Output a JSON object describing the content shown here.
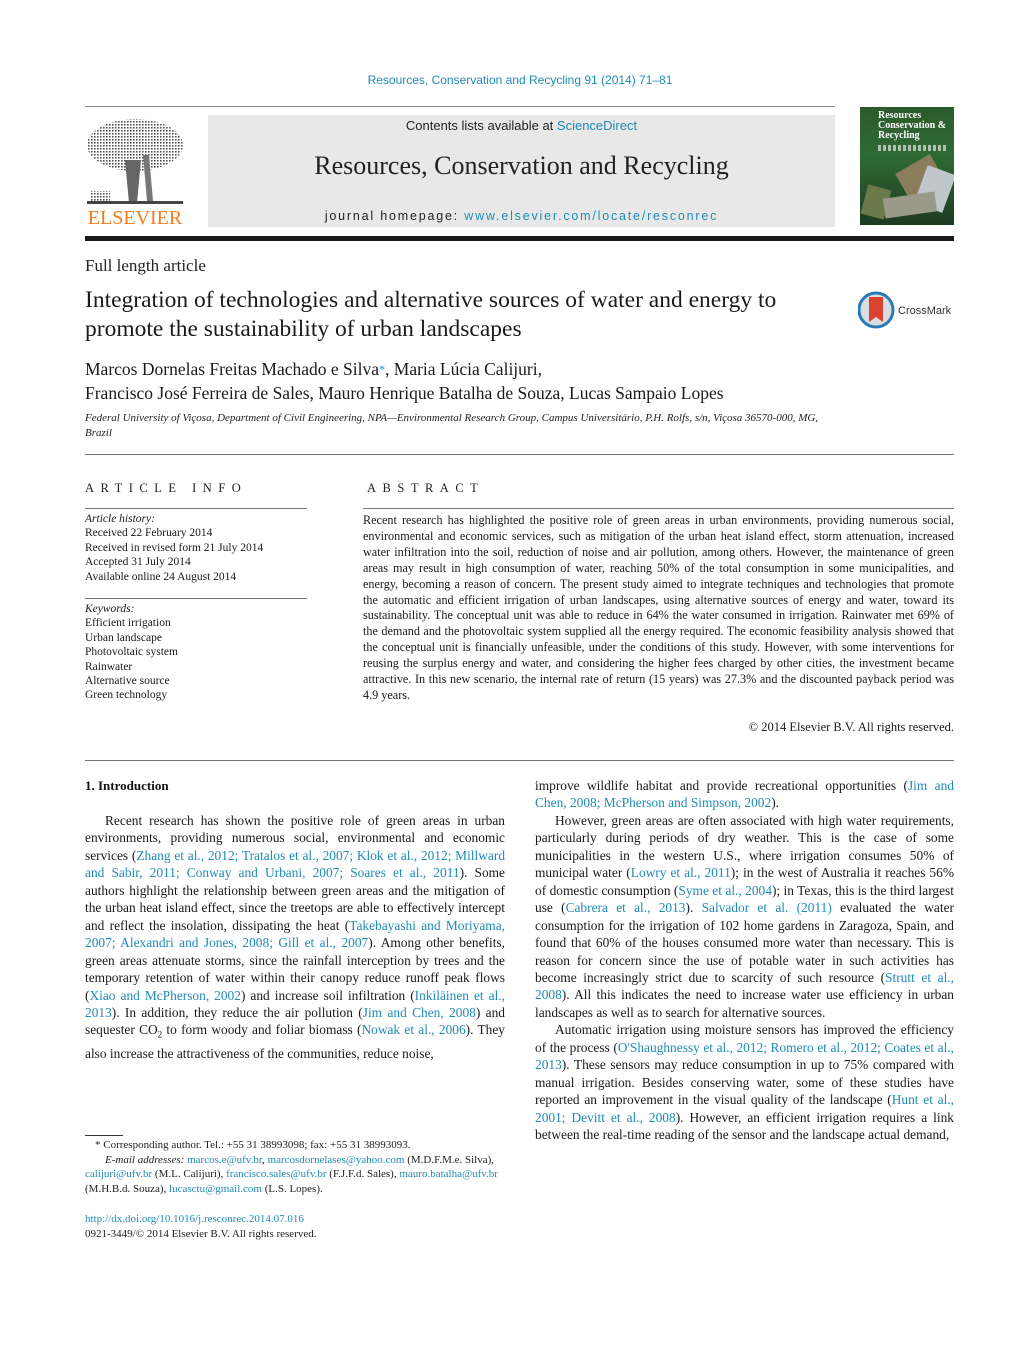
{
  "header": {
    "citation": "Resources, Conservation and Recycling 91 (2014) 71–81",
    "contents_prefix": "Contents lists available at ",
    "contents_link": "ScienceDirect",
    "journal_title": "Resources, Conservation and Recycling",
    "homepage_prefix": "journal homepage: ",
    "homepage_link": "www.elsevier.com/locate/resconrec",
    "publisher_logo_text": "ELSEVIER",
    "cover_title_lines": [
      "Resources",
      "Conservation &",
      "Recycling"
    ],
    "crossmark_label": "CrossMark"
  },
  "article": {
    "type": "Full length article",
    "title": "Integration of technologies and alternative sources of water and energy to promote the sustainability of urban landscapes",
    "authors_line1": "Marcos Dornelas Freitas Machado e Silva",
    "authors_star": "*",
    "authors_line1_rest": ", Maria Lúcia Calijuri,",
    "authors_line2": "Francisco José Ferreira de Sales, Mauro Henrique Batalha de Souza, Lucas Sampaio Lopes",
    "affiliation": "Federal University of Viçosa, Department of Civil Engineering, NPA—Environmental Research Group, Campus Universitário, P.H. Rolfs, s/n, Viçosa 36570-000, MG, Brazil"
  },
  "article_info": {
    "heading": "ARTICLE INFO",
    "history_label": "Article history:",
    "history": [
      "Received 22 February 2014",
      "Received in revised form 21 July 2014",
      "Accepted 31 July 2014",
      "Available online 24 August 2014"
    ],
    "keywords_label": "Keywords:",
    "keywords": [
      "Efficient irrigation",
      "Urban landscape",
      "Photovoltaic system",
      "Rainwater",
      "Alternative source",
      "Green technology"
    ]
  },
  "abstract": {
    "heading": "ABSTRACT",
    "text": "Recent research has highlighted the positive role of green areas in urban environments, providing numerous social, environmental and economic services, such as mitigation of the urban heat island effect, storm attenuation, increased water infiltration into the soil, reduction of noise and air pollution, among others. However, the maintenance of green areas may result in high consumption of water, reaching 50% of the total consumption in some municipalities, and energy, becoming a reason of concern. The present study aimed to integrate techniques and technologies that promote the automatic and efficient irrigation of urban landscapes, using alternative sources of energy and water, toward its sustainability. The conceptual unit was able to reduce in 64% the water consumed in irrigation. Rainwater met 69% of the demand and the photovoltaic system supplied all the energy required. The economic feasibility analysis showed that the conceptual unit is financially unfeasible, under the conditions of this study. However, with some interventions for reusing the surplus energy and water, and considering the higher fees charged by other cities, the investment became attractive. In this new scenario, the internal rate of return (15 years) was 27.3% and the discounted payback period was 4.9 years.",
    "copyright": "© 2014 Elsevier B.V. All rights reserved."
  },
  "body": {
    "intro_heading": "1.  Introduction",
    "left_paragraphs": [
      [
        {
          "t": "Recent research has shown the positive role of green areas in urban environments, providing numerous social, environmental and economic services ("
        },
        {
          "l": "Zhang et al., 2012; Tratalos et al., 2007; Klok et al., 2012; Millward and Sabir, 2011; Conway and Urbani, 2007; Soares et al., 2011"
        },
        {
          "t": "). Some authors highlight the relationship between green areas and the mitigation of the urban heat island effect, since the treetops are able to effectively intercept and reflect the insolation, dissipating the heat ("
        },
        {
          "l": "Takebayashi and Moriyama, 2007; Alexandri and Jones, 2008; Gill et al., 2007"
        },
        {
          "t": "). Among other benefits, green areas attenuate storms, since the rainfall interception by trees and the temporary retention of water within their canopy reduce runoff peak flows ("
        },
        {
          "l": "Xiao and McPherson, 2002"
        },
        {
          "t": ") and increase soil infiltration ("
        },
        {
          "l": "Inkiläinen et al., 2013"
        },
        {
          "t": "). In addition, they reduce the air pollution ("
        },
        {
          "l": "Jim and Chen, 2008"
        },
        {
          "t": ") and sequester CO"
        },
        {
          "s": "2"
        },
        {
          "t": " to form woody and foliar biomass ("
        },
        {
          "l": "Nowak et al., 2006"
        },
        {
          "t": "). They also increase the attractiveness of the communities, reduce noise,"
        }
      ]
    ],
    "right_paragraphs": [
      [
        {
          "t": "improve wildlife habitat and provide recreational opportunities ("
        },
        {
          "l": "Jim and Chen, 2008; McPherson and Simpson, 2002"
        },
        {
          "t": ")."
        }
      ],
      [
        {
          "t": "However, green areas are often associated with high water requirements, particularly during periods of dry weather. This is the case of some municipalities in the western U.S., where irrigation consumes 50% of municipal water ("
        },
        {
          "l": "Lowry et al., 2011"
        },
        {
          "t": "); in the west of Australia it reaches 56% of domestic consumption ("
        },
        {
          "l": "Syme et al., 2004"
        },
        {
          "t": "); in Texas, this is the third largest use ("
        },
        {
          "l": "Cabrera et al., 2013"
        },
        {
          "t": "). "
        },
        {
          "l": "Salvador et al. (2011)"
        },
        {
          "t": " evaluated the water consumption for the irrigation of 102 home gardens in Zaragoza, Spain, and found that 60% of the houses consumed more water than necessary. This is reason for concern since the use of potable water in such activities has become increasingly strict due to scarcity of such resource ("
        },
        {
          "l": "Strutt et al., 2008"
        },
        {
          "t": "). All this indicates the need to increase water use efficiency in urban landscapes as well as to search for alternative sources."
        }
      ],
      [
        {
          "t": "Automatic irrigation using moisture sensors has improved the efficiency of the process ("
        },
        {
          "l": "O'Shaughnessy et al., 2012; Romero et al., 2012; Coates et al., 2013"
        },
        {
          "t": "). These sensors may reduce consumption in up to 75% compared with manual irrigation. Besides conserving water, some of these studies have reported an improvement in the visual quality of the landscape ("
        },
        {
          "l": "Hunt et al., 2001; Devitt et al., 2008"
        },
        {
          "t": "). However, an efficient irrigation requires a link between the real-time reading of the sensor and the landscape actual demand,"
        }
      ]
    ]
  },
  "footnote": {
    "star_line": "* Corresponding author. Tel.: +55 31 38993098; fax: +55 31 38993093.",
    "email_label": "E-mail addresses: ",
    "emails": [
      {
        "email": "marcos.e@ufv.br",
        "who": ", "
      },
      {
        "email": "marcosdornelases@yahoo.com",
        "who": " (M.D.F.M.e. Silva), "
      },
      {
        "email": "calijuri@ufv.br",
        "who": " (M.L. Calijuri), "
      },
      {
        "email": "francisco.sales@ufv.br",
        "who": " (F.J.F.d. Sales), "
      },
      {
        "email": "mauro.batalha@ufv.br",
        "who": " (M.H.B.d. Souza), "
      },
      {
        "email": "lucasctu@gmail.com",
        "who": " (L.S. Lopes)."
      }
    ],
    "doi": "http://dx.doi.org/10.1016/j.resconrec.2014.07.016",
    "issn_copyright": "0921-3449/© 2014 Elsevier B.V. All rights reserved."
  },
  "colors": {
    "link": "#1f8bb5",
    "elsevier_orange": "#f07c1c",
    "journal_box": "#e8e8e8",
    "crossmark_red": "#d9432f",
    "crossmark_blue": "#2a7ab5"
  }
}
